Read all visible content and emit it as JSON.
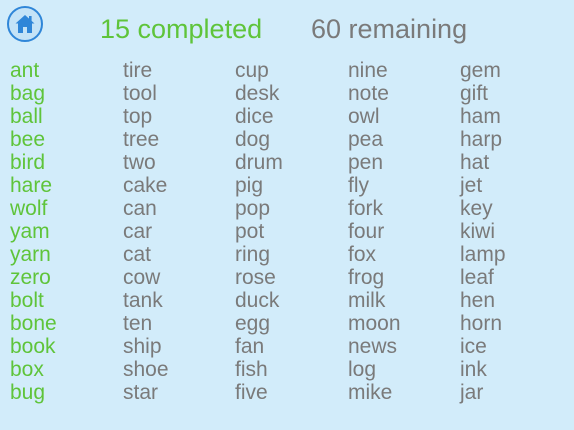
{
  "header": {
    "completed_label": "15 completed",
    "remaining_label": "60 remaining"
  },
  "icons": {
    "home": "home-icon"
  },
  "colors": {
    "background": "#d2ecfa",
    "completed": "#5fc43a",
    "remaining": "#7a7a7a",
    "home_icon": "#2f86d8"
  },
  "columns": [
    {
      "status": "completed",
      "words": [
        "ant",
        "bag",
        "ball",
        "bee",
        "bird",
        "hare",
        "wolf",
        "yam",
        "yarn",
        "zero",
        "bolt",
        "bone",
        "book",
        "box",
        "bug"
      ]
    },
    {
      "status": "remaining",
      "words": [
        "tire",
        "tool",
        "top",
        "tree",
        "two",
        "cake",
        "can",
        "car",
        "cat",
        "cow",
        "tank",
        "ten",
        "ship",
        "shoe",
        "star"
      ]
    },
    {
      "status": "remaining",
      "words": [
        "cup",
        "desk",
        "dice",
        "dog",
        "drum",
        "pig",
        "pop",
        "pot",
        "ring",
        "rose",
        "duck",
        "egg",
        "fan",
        "fish",
        "five"
      ]
    },
    {
      "status": "remaining",
      "words": [
        "nine",
        "note",
        "owl",
        "pea",
        "pen",
        "fly",
        "fork",
        "four",
        "fox",
        "frog",
        "milk",
        "moon",
        "news",
        "log",
        "mike"
      ]
    },
    {
      "status": "remaining",
      "words": [
        "gem",
        "gift",
        "ham",
        "harp",
        "hat",
        "jet",
        "key",
        "kiwi",
        "lamp",
        "leaf",
        "hen",
        "horn",
        "ice",
        "ink",
        "jar"
      ]
    }
  ]
}
